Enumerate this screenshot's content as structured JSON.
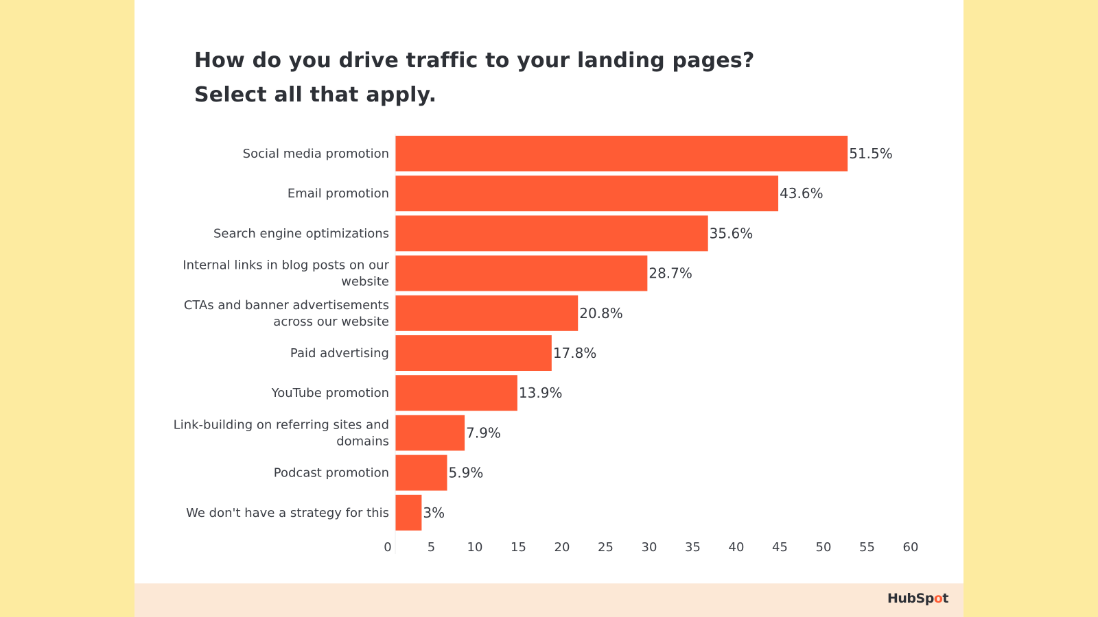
{
  "colors": {
    "background": "#FDEBA0",
    "card": "#FFFFFF",
    "footer": "#FCE8D6",
    "bar": "#FF5C35",
    "text": "#33363D"
  },
  "brand": {
    "logo_text_before": "HubSp",
    "logo_sprocket": "o",
    "logo_text_after": "t",
    "logo_icon": "hubspot-sprocket-icon"
  },
  "chart_data": {
    "type": "bar",
    "orientation": "horizontal",
    "title": "How do you drive traffic to your landing pages?",
    "subtitle": "Select all that apply.",
    "xlabel": "",
    "ylabel": "",
    "xlim": [
      0,
      60
    ],
    "x_ticks": [
      0,
      5,
      10,
      15,
      20,
      25,
      30,
      35,
      40,
      45,
      50,
      55,
      60
    ],
    "grid": false,
    "legend": "none",
    "categories": [
      [
        "Social media promotion"
      ],
      [
        "Email promotion"
      ],
      [
        "Search engine optimizations"
      ],
      [
        "Internal links in blog posts on our",
        "website"
      ],
      [
        "CTAs and banner advertisements",
        "across our website"
      ],
      [
        "Paid advertising"
      ],
      [
        "YouTube promotion"
      ],
      [
        "Link-building on referring sites and",
        "domains"
      ],
      [
        "Podcast promotion"
      ],
      [
        "We don't have a strategy for this"
      ]
    ],
    "values": [
      51.5,
      43.6,
      35.6,
      28.7,
      20.8,
      17.8,
      13.9,
      7.9,
      5.9,
      3
    ],
    "value_labels": [
      "51.5%",
      "43.6%",
      "35.6%",
      "28.7%",
      "20.8%",
      "17.8%",
      "13.9%",
      "7.9%",
      "5.9%",
      "3%"
    ]
  }
}
